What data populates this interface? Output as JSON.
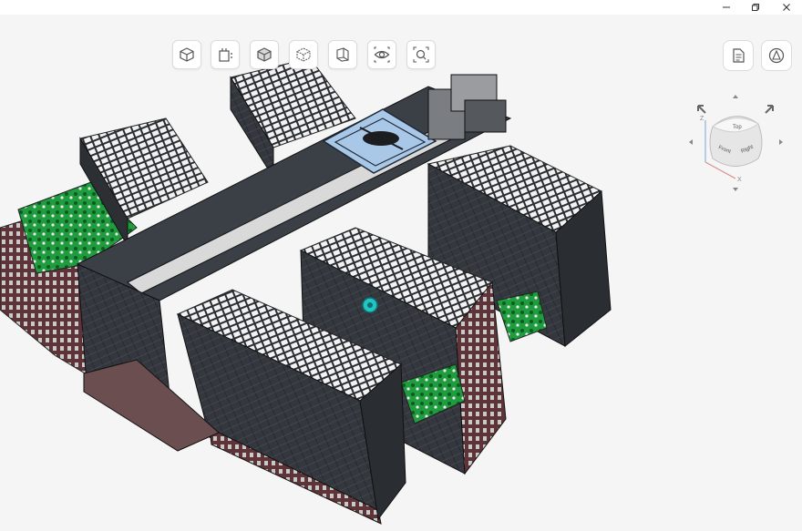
{
  "window": {
    "controls": [
      "minimize",
      "restore",
      "close"
    ]
  },
  "toolbar": {
    "buttons": [
      {
        "icon": "perspective-cube-icon"
      },
      {
        "icon": "section-box-icon"
      },
      {
        "icon": "solid-cube-icon"
      },
      {
        "icon": "wireframe-cube-icon"
      },
      {
        "icon": "floor-plan-icon"
      },
      {
        "icon": "eye-icon"
      },
      {
        "icon": "fit-view-icon"
      }
    ]
  },
  "side_tools": {
    "buttons": [
      {
        "icon": "document-icon"
      },
      {
        "icon": "layers-cone-icon"
      }
    ]
  },
  "viewcube": {
    "faces": {
      "top": "Top",
      "front": "Front",
      "right": "Right"
    },
    "axes": {
      "x": "X",
      "z": "Z"
    }
  },
  "colors": {
    "building": "#3a3e45",
    "building_dark": "#25282d",
    "roof_panels": "#f0f0f0",
    "greenery": "#1e9c3c",
    "brick": "#6a3b3e",
    "helipad": "#a9c8e8",
    "marker": "#22c4c4"
  }
}
